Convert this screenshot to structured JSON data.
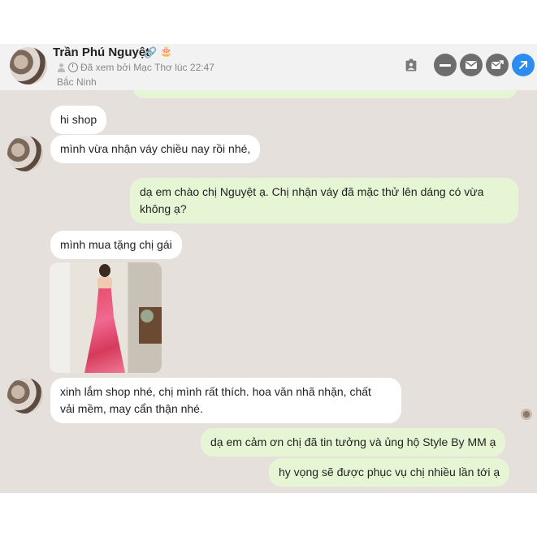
{
  "header": {
    "name": "Trần Phú Nguyệt",
    "seen_text": "Đã xem bởi Mạc Thơ lúc 22:47",
    "location": "Bắc Ninh",
    "icons": [
      "contact-card-icon",
      "minus-icon",
      "mail-icon",
      "mail-forward-icon",
      "open-external-icon"
    ]
  },
  "messages": [
    {
      "side": "in",
      "text": "hi shop"
    },
    {
      "side": "in",
      "text": "mình vừa nhận váy chiều nay rồi nhé,"
    },
    {
      "side": "out",
      "line1": "dạ em chào chị Nguyệt ạ. Chị nhận váy đã mặc thử lên dáng có vừa",
      "line2": "không ạ?"
    },
    {
      "side": "in",
      "text": "mình mua tặng chị gái"
    },
    {
      "side": "in",
      "type": "image",
      "icon": "dress-photo"
    },
    {
      "side": "in",
      "line1": "xinh lắm shop nhé, chị mình rất thích. hoa văn nhã nhặn, chất",
      "line2": "vải mềm, may cẩn thận nhé."
    },
    {
      "side": "out",
      "text": "dạ em cảm ơn chị đã tin tưởng và ủng hộ Style By MM ạ"
    },
    {
      "side": "out",
      "text": "hy vọng sẽ được phục vụ chị nhiều lần tới ạ"
    }
  ],
  "colors": {
    "chat_bg": "#e5e0dc",
    "incoming": "#ffffff",
    "outgoing": "#e6f6d5",
    "accent": "#2d8cf0"
  }
}
